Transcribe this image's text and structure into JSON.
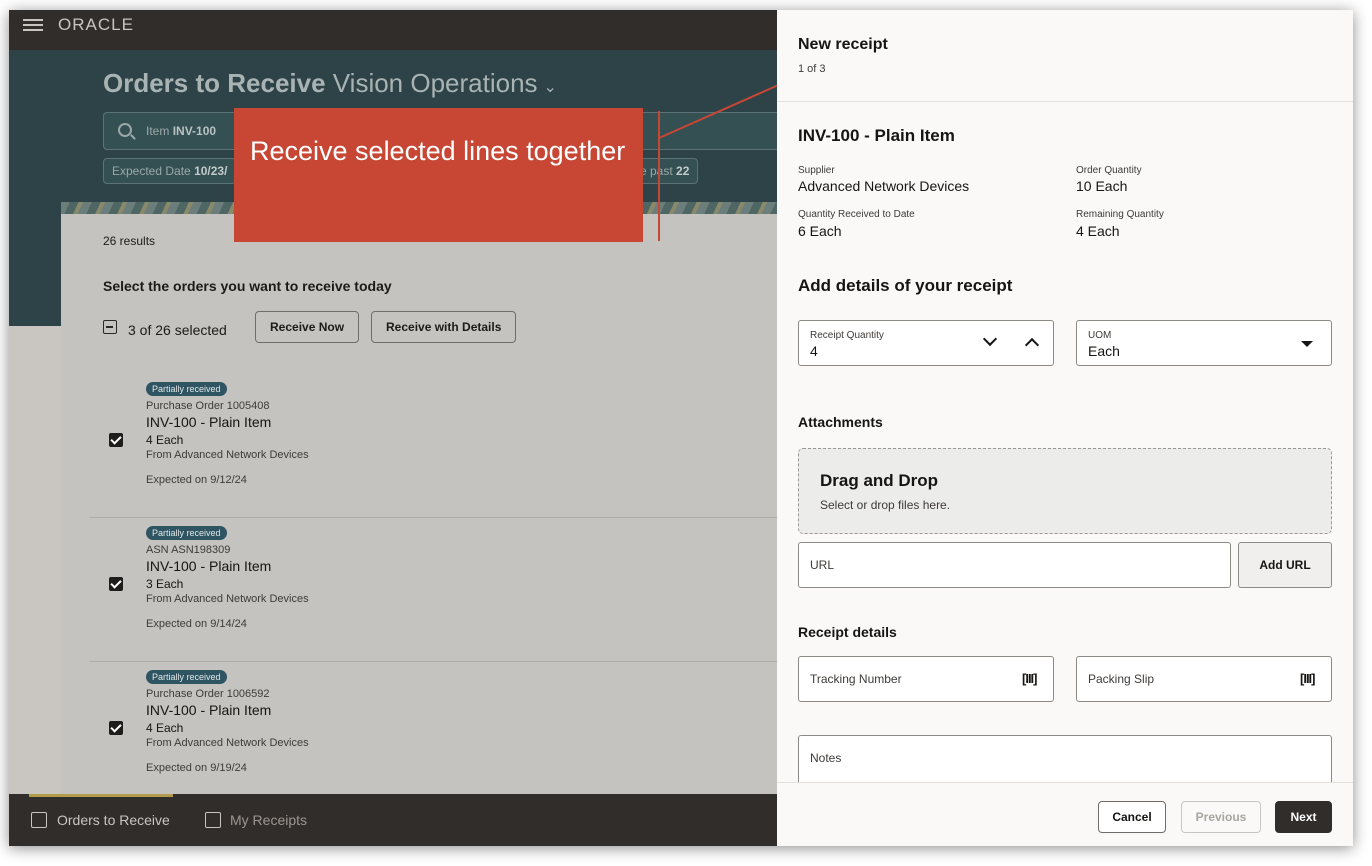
{
  "app": {
    "logo": "ORACLE"
  },
  "header": {
    "title_bold": "Orders to Receive",
    "title_org": "Vision Operations",
    "org_chevron": "chevron-down-icon"
  },
  "search": {
    "chip_label": "Item",
    "chip_value": "INV-100"
  },
  "filters": [
    {
      "label": "Expected Date",
      "value": "10/23/"
    },
    {
      "label": "e past",
      "value": "22"
    }
  ],
  "list": {
    "results": "26 results",
    "heading": "Select the orders you want to receive today",
    "selected": "3 of 26 selected",
    "receive_now": "Receive Now",
    "receive_details": "Receive with Details",
    "rows": [
      {
        "badge": "Partially received",
        "ref": "Purchase Order 1005408",
        "item": "INV-100 - Plain Item",
        "qty": "4 Each",
        "from": "From Advanced Network Devices",
        "expected": "Expected on 9/12/24"
      },
      {
        "badge": "Partially received",
        "ref": "ASN ASN198309",
        "item": "INV-100 - Plain Item",
        "qty": "3 Each",
        "from": "From Advanced Network Devices",
        "expected": "Expected on 9/14/24"
      },
      {
        "badge": "Partially received",
        "ref": "Purchase Order 1006592",
        "item": "INV-100 - Plain Item",
        "qty": "4 Each",
        "from": "From Advanced Network Devices",
        "expected": "Expected on 9/19/24"
      }
    ]
  },
  "bottom_nav": {
    "orders": "Orders to Receive",
    "receipts": "My Receipts"
  },
  "callout": {
    "text": "Receive selected lines together"
  },
  "panel": {
    "title": "New receipt",
    "counter": "1 of 3",
    "item": "INV-100 - Plain Item",
    "supplier_label": "Supplier",
    "supplier": "Advanced Network Devices",
    "order_qty_label": "Order Quantity",
    "order_qty": "10 Each",
    "received_label": "Quantity Received to Date",
    "received": "6 Each",
    "remaining_label": "Remaining Quantity",
    "remaining": "4 Each",
    "details_heading": "Add details of your receipt",
    "receipt_qty_label": "Receipt Quantity",
    "receipt_qty": "4",
    "uom_label": "UOM",
    "uom": "Each",
    "attachments_heading": "Attachments",
    "drop_title": "Drag and Drop",
    "drop_sub": "Select or drop files here.",
    "url_placeholder": "URL",
    "add_url": "Add URL",
    "receipt_details_heading": "Receipt details",
    "tracking_placeholder": "Tracking Number",
    "packing_placeholder": "Packing Slip",
    "notes_placeholder": "Notes",
    "cancel": "Cancel",
    "previous": "Previous",
    "next": "Next"
  }
}
